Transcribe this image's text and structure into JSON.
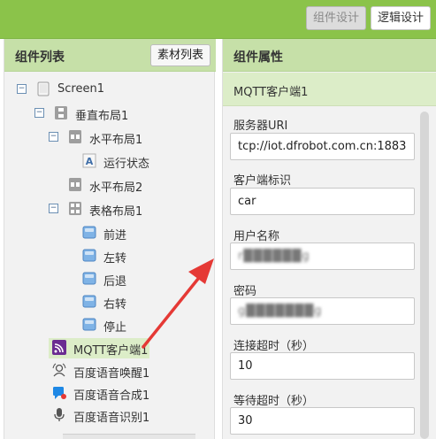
{
  "toolbar": {
    "component_design_label": "组件设计",
    "logic_design_label": "逻辑设计"
  },
  "left_panel": {
    "title": "组件列表",
    "material_button_label": "素材列表",
    "tree": [
      {
        "label": "Screen1",
        "icon": "screen-icon",
        "toggle": "−"
      },
      {
        "label": "垂直布局1",
        "icon": "vertical-layout-icon",
        "toggle": "−"
      },
      {
        "label": "水平布局1",
        "icon": "horizontal-layout-icon",
        "toggle": "−"
      },
      {
        "label": "运行状态",
        "icon": "label-icon"
      },
      {
        "label": "水平布局2",
        "icon": "horizontal-layout-icon"
      },
      {
        "label": "表格布局1",
        "icon": "table-layout-icon",
        "toggle": "−"
      },
      {
        "label": "前进",
        "icon": "button-icon"
      },
      {
        "label": "左转",
        "icon": "button-icon"
      },
      {
        "label": "后退",
        "icon": "button-icon"
      },
      {
        "label": "右转",
        "icon": "button-icon"
      },
      {
        "label": "停止",
        "icon": "button-icon"
      },
      {
        "label": "MQTT客户端1",
        "icon": "mqtt-icon",
        "selected": true
      },
      {
        "label": "百度语音唤醒1",
        "icon": "voice-wakeup-icon"
      },
      {
        "label": "百度语音合成1",
        "icon": "speech-synthesis-icon"
      },
      {
        "label": "百度语音识别1",
        "icon": "microphone-icon"
      }
    ]
  },
  "right_panel": {
    "title": "组件属性",
    "component_name": "MQTT客户端1",
    "properties": [
      {
        "label": "服务器URI",
        "value": "tcp://iot.dfrobot.com.cn:1883"
      },
      {
        "label": "客户端标识",
        "value": "car"
      },
      {
        "label": "用户名称",
        "value": "r██████g"
      },
      {
        "label": "密码",
        "value": "g███████g"
      },
      {
        "label": "连接超时（秒）",
        "value": "10"
      },
      {
        "label": "等待超时（秒）",
        "value": "30"
      }
    ]
  },
  "colors": {
    "toolbar_green": "#8bc34a",
    "header_green": "#c6e0a8",
    "selected_green": "#dcedc8",
    "arrow_red": "#e53935"
  }
}
